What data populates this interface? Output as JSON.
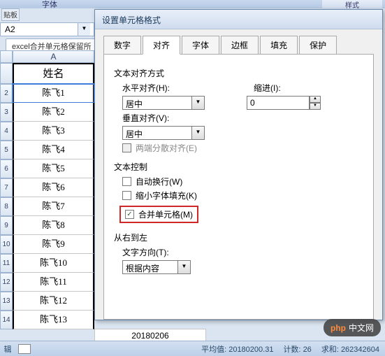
{
  "ribbon": {
    "clipboard": "贴板",
    "font": "字体",
    "styles": "样式"
  },
  "namebox": {
    "value": "A2"
  },
  "sheet_tab": "excel合并单元格保留所",
  "grid": {
    "col_header": "A",
    "header_cell": "姓名",
    "rows": [
      "陈飞1",
      "陈飞2",
      "陈飞3",
      "陈飞4",
      "陈飞5",
      "陈飞6",
      "陈飞7",
      "陈飞8",
      "陈飞9",
      "陈飞10",
      "陈飞11",
      "陈飞12",
      "陈飞13"
    ]
  },
  "extra_cells": [
    "20180206"
  ],
  "dialog": {
    "title": "设置单元格格式",
    "tabs": [
      "数字",
      "对齐",
      "字体",
      "边框",
      "填充",
      "保护"
    ],
    "active_tab": 1,
    "alignment": {
      "section": "文本对齐方式",
      "h_label": "水平对齐(H):",
      "h_value": "居中",
      "indent_label": "缩进(I):",
      "indent_value": "0",
      "v_label": "垂直对齐(V):",
      "v_value": "居中",
      "justify_label": "两端分散对齐(E)"
    },
    "text_control": {
      "section": "文本控制",
      "wrap": "自动换行(W)",
      "shrink": "缩小字体填充(K)",
      "merge": "合并单元格(M)",
      "merge_checked": true
    },
    "rtl": {
      "section": "从右到左",
      "dir_label": "文字方向(T):",
      "dir_value": "根据内容"
    }
  },
  "watermark": {
    "logo": "php",
    "text": "中文网"
  },
  "statusbar": {
    "mode": "辑",
    "avg_label": "平均值:",
    "avg": "20180200.31",
    "count_label": "计数:",
    "count": "26",
    "sum_label": "求和:",
    "sum": "262342604"
  }
}
